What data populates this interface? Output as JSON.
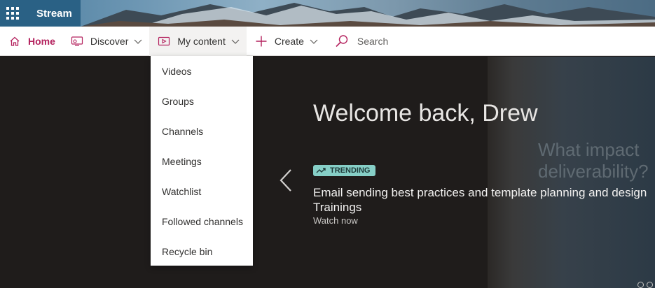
{
  "banner": {
    "app_name": "Stream"
  },
  "nav": {
    "home": "Home",
    "discover": "Discover",
    "my_content": "My content",
    "create": "Create",
    "search_placeholder": "Search"
  },
  "dropdown": {
    "items": [
      "Videos",
      "Groups",
      "Channels",
      "Meetings",
      "Watchlist",
      "Followed channels",
      "Recycle bin"
    ]
  },
  "hero": {
    "welcome": "Welcome back, Drew",
    "badge": "TRENDING",
    "video_title": "Email sending best practices and template planning and design Trainings",
    "watch_now": "Watch now",
    "thumbnail_text_line1": "What impact",
    "thumbnail_text_line2": "deliverability?"
  },
  "colors": {
    "brand": "#b4225e",
    "app_tile": "#2a6185",
    "trending_badge": "#86cfc7"
  }
}
